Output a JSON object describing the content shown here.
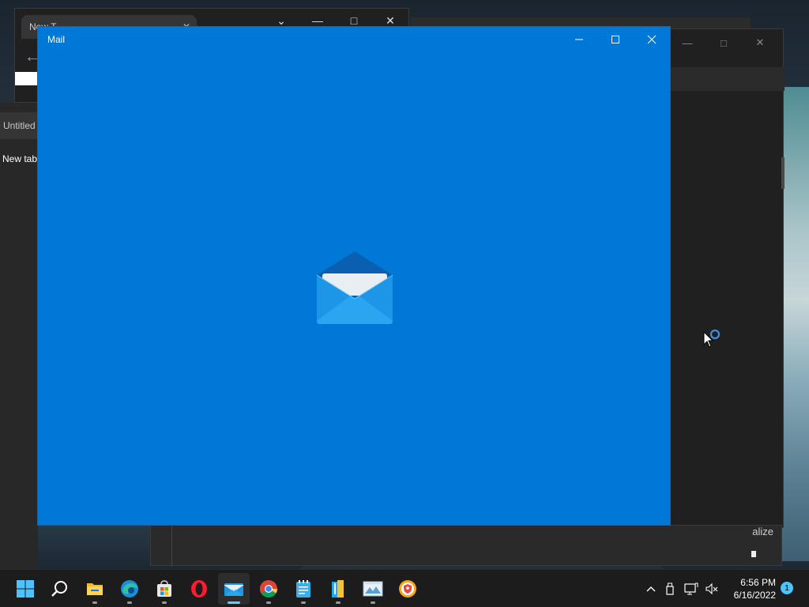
{
  "background": {
    "browser_tab_label": "New T",
    "left_panel_item_1": "Untitled",
    "left_panel_item_2": "New tab",
    "bottom_window_text": "alize"
  },
  "mail_window": {
    "title": "Mail",
    "bg_color": "#0078d7",
    "controls": [
      "minimize-icon",
      "maximize-icon",
      "close-icon"
    ]
  },
  "taskbar": {
    "pinned": [
      {
        "name": "start",
        "icon": "windows-logo-icon"
      },
      {
        "name": "search",
        "icon": "search-icon"
      },
      {
        "name": "file-explorer",
        "icon": "folder-icon"
      },
      {
        "name": "edge",
        "icon": "edge-icon"
      },
      {
        "name": "microsoft-store",
        "icon": "store-icon"
      },
      {
        "name": "opera",
        "icon": "opera-icon"
      },
      {
        "name": "mail",
        "icon": "mail-icon",
        "active": true
      },
      {
        "name": "chrome",
        "icon": "chrome-icon"
      },
      {
        "name": "notepad",
        "icon": "notepad-icon"
      },
      {
        "name": "winrar",
        "icon": "archive-icon"
      },
      {
        "name": "photos",
        "icon": "image-viewer-icon"
      },
      {
        "name": "vpn",
        "icon": "shield-vpn-icon"
      }
    ],
    "tray": {
      "chevron": "chevron-up-icon",
      "icons": [
        "usb-icon",
        "network-display-icon",
        "volume-muted-icon"
      ]
    },
    "clock": {
      "time": "6:56 PM",
      "date": "6/16/2022"
    },
    "notification_count": "1"
  }
}
